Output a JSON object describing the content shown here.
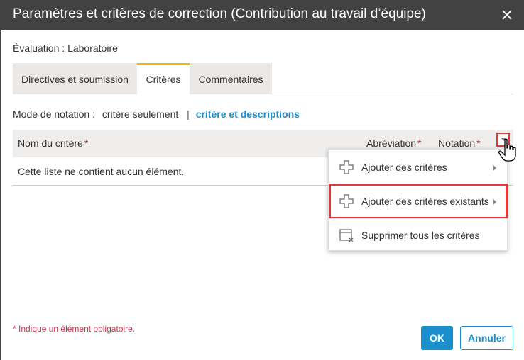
{
  "dialog": {
    "title": "Paramètres et critères de correction (Contribution au travail d’équipe)",
    "close_icon": "close-icon"
  },
  "evaluation": {
    "label": "Évaluation :",
    "value": "Laboratoire"
  },
  "tabs": [
    {
      "label": "Directives et soumission",
      "active": false
    },
    {
      "label": "Critères",
      "active": true
    },
    {
      "label": "Commentaires",
      "active": false
    }
  ],
  "grading_mode": {
    "label": "Mode de notation :",
    "option1": "critère seulement",
    "separator": "|",
    "option2": "critère et descriptions"
  },
  "table": {
    "columns": [
      {
        "label": "Nom du critère",
        "required": "*"
      },
      {
        "label": "Abréviation",
        "required": "*"
      },
      {
        "label": "Notation",
        "required": "*"
      }
    ],
    "empty_message": "Cette liste ne contient aucun élément."
  },
  "context_menu": {
    "items": [
      {
        "label": "Ajouter des critères",
        "icon": "plus-icon",
        "has_submenu": true
      },
      {
        "label": "Ajouter des critères existants",
        "icon": "plus-icon",
        "has_submenu": true,
        "highlighted": true
      },
      {
        "label": "Supprimer tous les critères",
        "icon": "delete-table-icon",
        "has_submenu": false
      }
    ]
  },
  "footer": {
    "required_note": "* Indique un élément obligatoire.",
    "ok_label": "OK",
    "cancel_label": "Annuler"
  },
  "colors": {
    "titlebar": "#424242",
    "accent": "#1b8fcc",
    "active_tab": "#f0b400",
    "required": "#c8304a",
    "highlight": "#e53935"
  }
}
